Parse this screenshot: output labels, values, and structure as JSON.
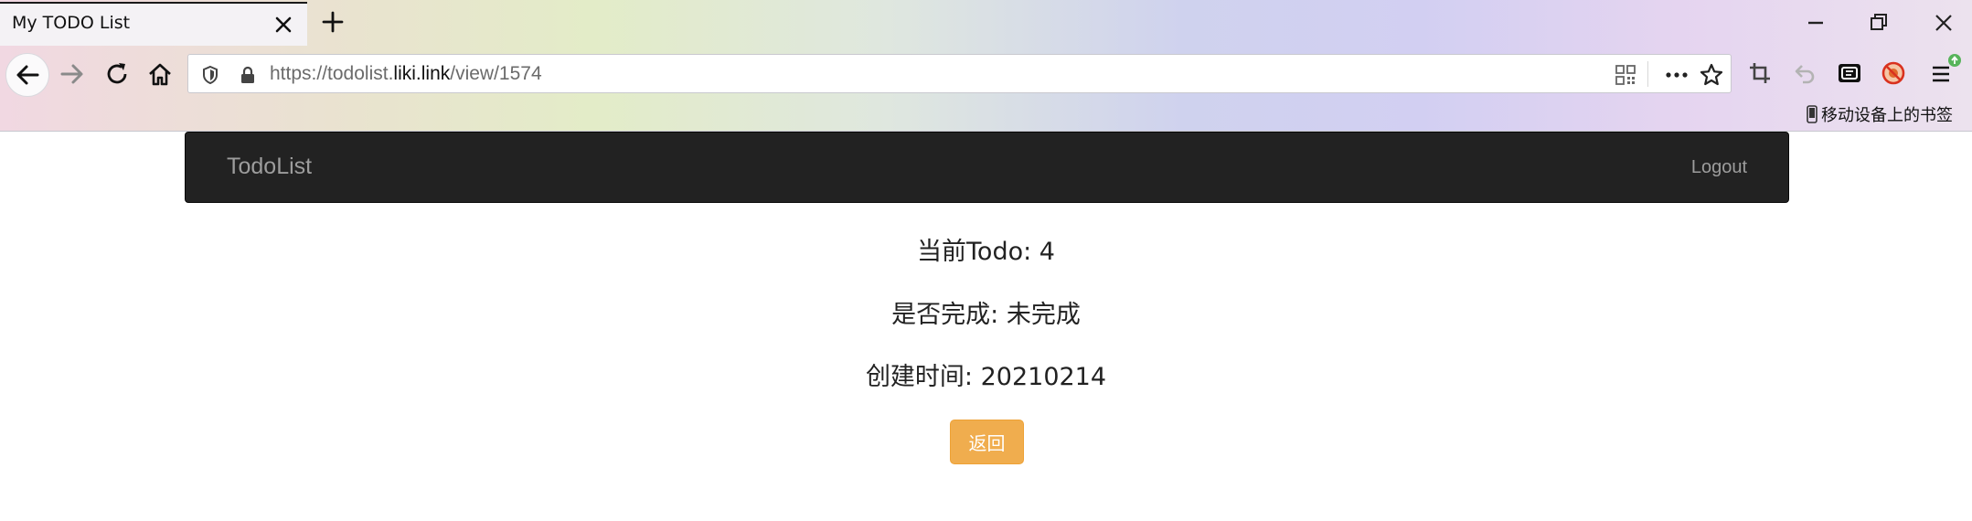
{
  "browser": {
    "tab_title": "My TODO List",
    "url_prefix": "https://todolist.",
    "url_host": "liki.link",
    "url_path": "/view/1574",
    "mobile_bookmarks_label": "移动设备上的书签"
  },
  "navbar": {
    "brand": "TodoList",
    "logout_label": "Logout"
  },
  "detail": {
    "current_todo": "当前Todo: 4",
    "completed_status": "是否完成: 未完成",
    "created_time": "创建时间: 20210214",
    "back_button_label": "返回"
  },
  "colors": {
    "navbar_bg": "#222222",
    "navbar_text": "#9d9d9d",
    "warning_button": "#f0ad4e"
  }
}
